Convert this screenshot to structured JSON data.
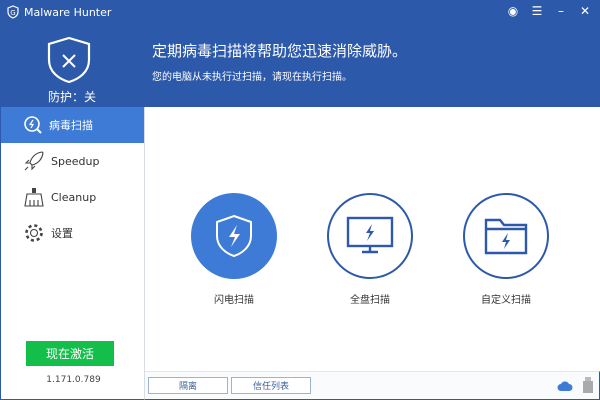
{
  "app": {
    "title": "Malware Hunter"
  },
  "header": {
    "headline": "定期病毒扫描将帮助您迅速消除威胁。",
    "subtext": "您的电脑从未执行过扫描，请现在执行扫描。",
    "protection": "防护：关"
  },
  "sidebar": {
    "items": [
      {
        "label": "病毒扫描"
      },
      {
        "label": "Speedup"
      },
      {
        "label": "Cleanup"
      },
      {
        "label": "设置"
      }
    ],
    "activate": "现在激活",
    "version": "1.171.0.789"
  },
  "main": {
    "scans": [
      {
        "label": "闪电扫描"
      },
      {
        "label": "全盘扫描"
      },
      {
        "label": "自定义扫描"
      }
    ]
  },
  "bottom": {
    "quarantine": "隔离",
    "trust_list": "信任列表"
  },
  "colors": {
    "header": "#2c59a9",
    "accent": "#3d7bd6",
    "activate": "#13be4a"
  }
}
